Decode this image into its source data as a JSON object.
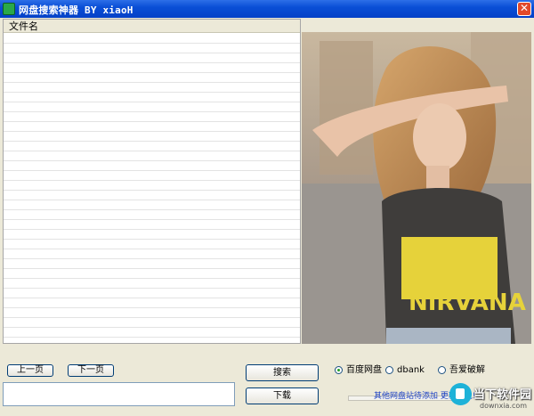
{
  "window": {
    "title": "网盘搜索神器 BY xiaoH",
    "close_glyph": "✕"
  },
  "list": {
    "column_header": "文件名",
    "rows": []
  },
  "buttons": {
    "prev": "上一页",
    "next": "下一页",
    "search": "搜索",
    "download": "下载"
  },
  "search_box": {
    "value": ""
  },
  "radios": [
    {
      "label": "百度网盘",
      "selected": true
    },
    {
      "label": "dbank",
      "selected": false
    },
    {
      "label": "吾爱破解",
      "selected": false
    }
  ],
  "footer": {
    "link_text": "其他网盘站待添加 更新再说!"
  },
  "watermark": {
    "text": "当下软件园",
    "url": "downxia.com"
  },
  "colors": {
    "titlebar": "#0a4fd6",
    "accent_link": "#1a3fc4",
    "window_bg": "#ece9d8"
  },
  "icons": {
    "app": "app-icon",
    "close": "close-icon"
  }
}
